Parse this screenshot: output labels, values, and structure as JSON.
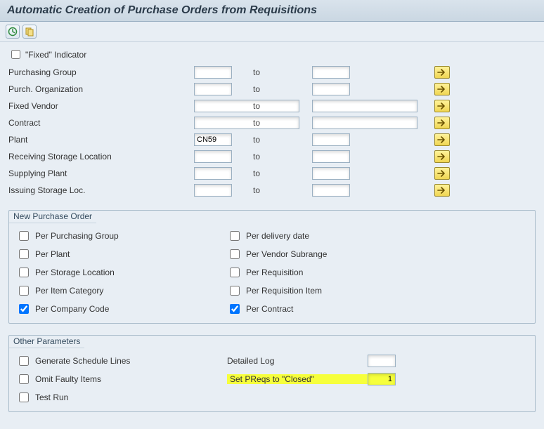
{
  "title": "Automatic Creation of Purchase Orders from Requisitions",
  "criteria": {
    "fixed_indicator_label": "\"Fixed\" Indicator",
    "fixed_indicator_checked": false,
    "to_label": "to",
    "rows": [
      {
        "label": "Purchasing Group",
        "from": "",
        "to": "",
        "size": "sm"
      },
      {
        "label": "Purch. Organization",
        "from": "",
        "to": "",
        "size": "sm"
      },
      {
        "label": "Fixed Vendor",
        "from": "",
        "to": "",
        "size": "lg"
      },
      {
        "label": "Contract",
        "from": "",
        "to": "",
        "size": "lg"
      },
      {
        "label": "Plant",
        "from": "CN59",
        "to": "",
        "size": "sm"
      },
      {
        "label": "Receiving Storage Location",
        "from": "",
        "to": "",
        "size": "sm"
      },
      {
        "label": "Supplying Plant",
        "from": "",
        "to": "",
        "size": "sm"
      },
      {
        "label": "Issuing Storage Loc.",
        "from": "",
        "to": "",
        "size": "sm"
      }
    ]
  },
  "new_po": {
    "title": "New Purchase Order",
    "left": [
      {
        "label": "Per Purchasing Group",
        "checked": false
      },
      {
        "label": "Per Plant",
        "checked": false
      },
      {
        "label": "Per Storage Location",
        "checked": false
      },
      {
        "label": "Per Item Category",
        "checked": false
      },
      {
        "label": "Per Company Code",
        "checked": true
      }
    ],
    "right": [
      {
        "label": "Per delivery date",
        "checked": false
      },
      {
        "label": "Per Vendor Subrange",
        "checked": false
      },
      {
        "label": "Per Requisition",
        "checked": false
      },
      {
        "label": "Per Requisition Item",
        "checked": false
      },
      {
        "label": "Per Contract",
        "checked": true
      }
    ]
  },
  "other": {
    "title": "Other Parameters",
    "generate_schedule_lines": {
      "label": "Generate Schedule Lines",
      "checked": false
    },
    "omit_faulty_items": {
      "label": "Omit Faulty Items",
      "checked": false
    },
    "test_run": {
      "label": "Test Run",
      "checked": false
    },
    "detailed_log": {
      "label": "Detailed Log",
      "value": ""
    },
    "set_preqs_closed": {
      "label": "Set PReqs to \"Closed\"",
      "value": "1"
    }
  }
}
